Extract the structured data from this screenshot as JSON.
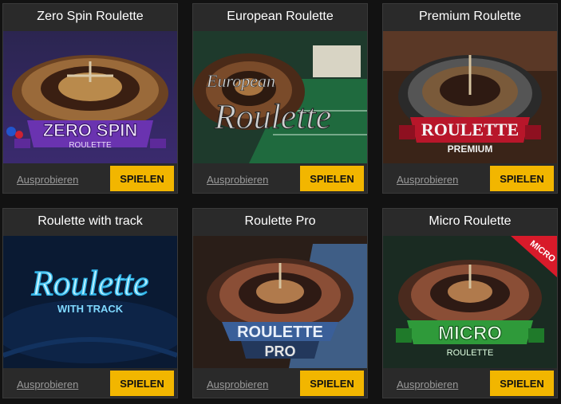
{
  "games": [
    {
      "title": "Zero Spin Roulette",
      "logo_line1": "ZERO SPIN",
      "logo_line2": "ROULETTE",
      "try_label": "Ausprobieren",
      "play_label": "SPIELEN"
    },
    {
      "title": "European Roulette",
      "logo_line1": "European",
      "logo_line2": "Roulette",
      "try_label": "Ausprobieren",
      "play_label": "SPIELEN"
    },
    {
      "title": "Premium Roulette",
      "logo_line1": "ROULETTE",
      "logo_line2": "PREMIUM",
      "try_label": "Ausprobieren",
      "play_label": "SPIELEN"
    },
    {
      "title": "Roulette with track",
      "logo_line1": "Roulette",
      "logo_line2": "WITH TRACK",
      "try_label": "Ausprobieren",
      "play_label": "SPIELEN"
    },
    {
      "title": "Roulette Pro",
      "logo_line1": "ROULETTE",
      "logo_line2": "PRO",
      "try_label": "Ausprobieren",
      "play_label": "SPIELEN"
    },
    {
      "title": "Micro Roulette",
      "logo_line1": "MICRO",
      "logo_line2": "ROULETTE",
      "ribbon": "MICRO",
      "try_label": "Ausprobieren",
      "play_label": "SPIELEN"
    }
  ]
}
